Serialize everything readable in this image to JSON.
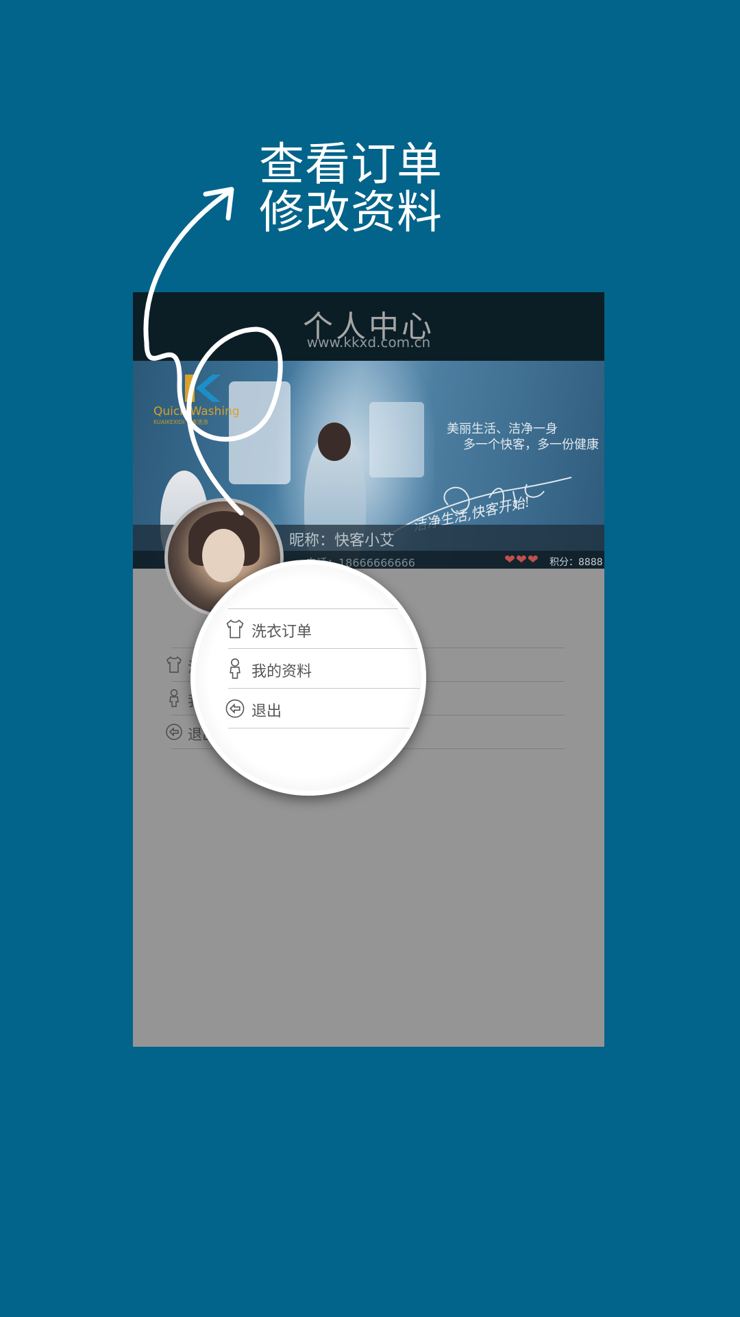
{
  "promo": {
    "line1": "查看订单",
    "line2": "修改资料"
  },
  "header": {
    "title": "个人中心",
    "url": "www.kkxd.com.cn"
  },
  "banner": {
    "logo_text": "Quick Washing",
    "logo_sub": "KUAIKEXIDI 快客洗涤",
    "slogan_line1": "美丽生活、洁净一身",
    "slogan_line2": "多一个快客，多一份健康",
    "signature_text": "洁净生活,快客开始!"
  },
  "profile": {
    "nickname": "昵称：快客小艾",
    "phone": "电话：18666666666",
    "hearts": "❤❤❤",
    "points": "积分：8888"
  },
  "menu": {
    "items": [
      {
        "label": "洗衣订单",
        "icon": "shirt-icon"
      },
      {
        "label": "我的资料",
        "icon": "person-icon"
      },
      {
        "label": "退出",
        "icon": "exit-icon"
      }
    ]
  },
  "colors": {
    "background": "#02648a",
    "title_bar": "#0c1e25",
    "heart": "#c0504d",
    "content": "#959595"
  }
}
